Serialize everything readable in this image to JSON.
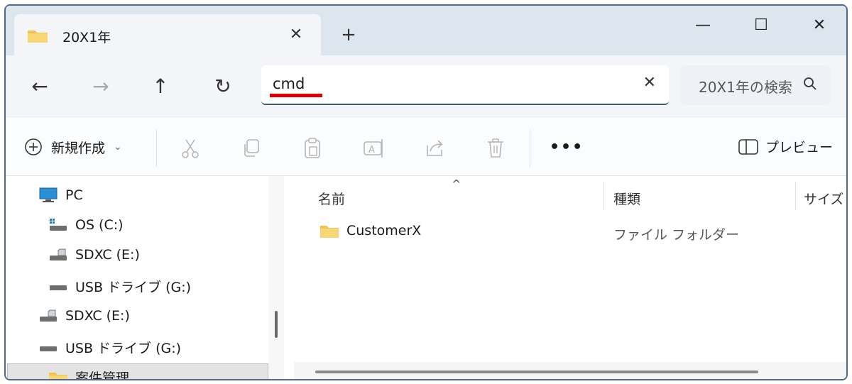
{
  "tab": {
    "title": "20X1年",
    "close": "✕"
  },
  "new_tab": "+",
  "window_controls": {
    "minimize": "—",
    "maximize": "☐",
    "close": "✕"
  },
  "nav": {
    "back": "←",
    "forward": "→",
    "up": "↑",
    "refresh": "↻"
  },
  "address": {
    "value": "cmd",
    "clear": "✕",
    "underline_color": "#e00000"
  },
  "search": {
    "placeholder": "20X1年の検索"
  },
  "command_bar": {
    "new_label": "新規作成",
    "more": "•••",
    "preview_label": "プレビュー",
    "icons": [
      "cut-icon",
      "copy-icon",
      "paste-icon",
      "rename-icon",
      "share-icon",
      "delete-icon"
    ]
  },
  "tree": {
    "items": [
      {
        "label": "PC",
        "icon": "computer-icon"
      },
      {
        "label": "OS (C:)",
        "icon": "drive-icon"
      },
      {
        "label": "SDXC (E:)",
        "icon": "sd-card-icon"
      },
      {
        "label": "USB ドライブ (G:)",
        "icon": "usb-drive-icon"
      },
      {
        "label": "SDXC (E:)",
        "icon": "sd-card-icon"
      },
      {
        "label": "USB ドライブ (G:)",
        "icon": "usb-drive-icon"
      },
      {
        "label": "案件管理",
        "icon": "folder-icon",
        "selected": true
      }
    ]
  },
  "columns": {
    "name": "名前",
    "type": "種類",
    "size": "サイズ"
  },
  "files": [
    {
      "name": "CustomerX",
      "type": "ファイル フォルダー",
      "icon": "folder-icon"
    }
  ],
  "colors": {
    "accent": "#3b5b7a",
    "folder": "#f2c14e",
    "titlebar": "#dde5ef"
  }
}
